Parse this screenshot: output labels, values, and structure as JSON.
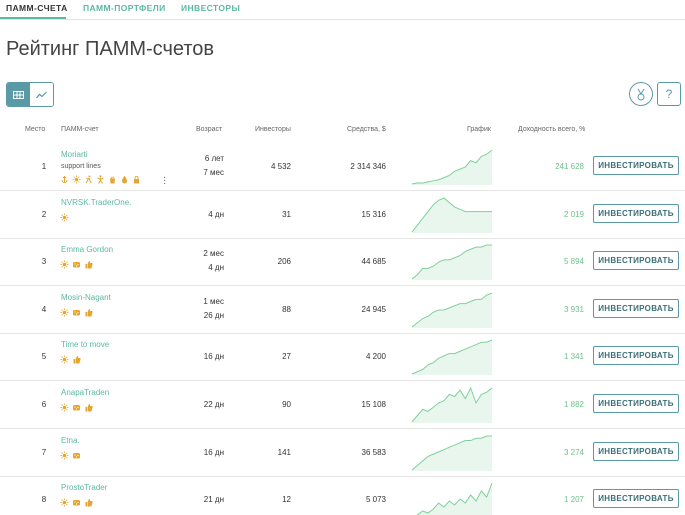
{
  "tabs": [
    {
      "label": "ПАММ-счета",
      "active": true
    },
    {
      "label": "ПАММ-портфели",
      "active": false
    },
    {
      "label": "Инвесторы",
      "active": false
    }
  ],
  "page_title": "Рейтинг ПАММ-счетов",
  "help_label": "?",
  "columns": {
    "rank": "Место",
    "account": "ПАММ-счет",
    "age": "Возраст",
    "investors": "Инвесторы",
    "funds": "Средства, $",
    "chart": "График",
    "yield": "Доходность всего, %"
  },
  "invest_label": "ИНВЕСТИРОВАТЬ",
  "accent_color": "#5cb8a3",
  "yield_color": "#6dc28a",
  "rows": [
    {
      "rank": "1",
      "name": "Moriarti",
      "subtitle": "support lines",
      "age1": "6 лет",
      "age2": "7 мес",
      "investors": "4 532",
      "funds": "2 314 346",
      "yield": "241 628",
      "icons": [
        "anchor-icon",
        "sun-icon",
        "runner-icon",
        "dancer-icon",
        "bag-icon",
        "drop-icon",
        "lock-icon"
      ],
      "has_more": true,
      "spark": [
        2,
        2.5,
        2.4,
        3,
        3.5,
        4,
        5,
        6,
        8,
        9,
        10,
        13,
        12,
        15,
        16,
        18
      ]
    },
    {
      "rank": "2",
      "name": "NVRSK.TraderOne.",
      "subtitle": "",
      "age1": "4 дн",
      "age2": "",
      "investors": "31",
      "funds": "15 316",
      "yield": "2 019",
      "icons": [
        "sun-icon"
      ],
      "has_more": false,
      "spark": [
        2,
        5,
        8,
        11,
        14,
        16,
        17,
        15,
        13,
        12,
        11,
        11,
        11,
        11,
        11,
        11
      ]
    },
    {
      "rank": "3",
      "name": "Emma Gordon",
      "subtitle": "",
      "age1": "2 мес",
      "age2": "4 дн",
      "investors": "206",
      "funds": "44 685",
      "yield": "5 894",
      "icons": [
        "sun-icon",
        "cookie-icon",
        "thumb-icon"
      ],
      "has_more": false,
      "spark": [
        1,
        3,
        6,
        6,
        7,
        9,
        10,
        10,
        11,
        12,
        14,
        15,
        16,
        16,
        17,
        17
      ]
    },
    {
      "rank": "4",
      "name": "Mosin-Nagant",
      "subtitle": "",
      "age1": "1 мес",
      "age2": "26 дн",
      "investors": "88",
      "funds": "24 945",
      "yield": "3 931",
      "icons": [
        "sun-icon",
        "cookie-icon",
        "thumb-icon"
      ],
      "has_more": false,
      "spark": [
        1,
        3,
        5,
        6,
        8,
        9,
        9,
        10,
        11,
        12,
        12,
        13,
        14,
        14,
        16,
        17
      ]
    },
    {
      "rank": "5",
      "name": "Time to move",
      "subtitle": "",
      "age1": "16 дн",
      "age2": "",
      "investors": "27",
      "funds": "4 200",
      "yield": "1 341",
      "icons": [
        "sun-icon",
        "thumb-icon"
      ],
      "has_more": false,
      "spark": [
        1,
        2,
        3,
        5,
        6,
        8,
        9,
        10,
        10,
        11,
        12,
        13,
        14,
        15,
        15,
        16
      ]
    },
    {
      "rank": "6",
      "name": "AnapaTraden",
      "subtitle": "",
      "age1": "22 дн",
      "age2": "",
      "investors": "90",
      "funds": "15 108",
      "yield": "1 882",
      "icons": [
        "sun-icon",
        "cookie-icon",
        "thumb-icon"
      ],
      "has_more": false,
      "spark": [
        1,
        4,
        7,
        6,
        8,
        10,
        11,
        14,
        13,
        16,
        12,
        17,
        10,
        14,
        15,
        17
      ]
    },
    {
      "rank": "7",
      "name": "Etna.",
      "subtitle": "",
      "age1": "16 дн",
      "age2": "",
      "investors": "141",
      "funds": "36 583",
      "yield": "3 274",
      "icons": [
        "sun-icon",
        "cookie-icon"
      ],
      "has_more": false,
      "spark": [
        1,
        3,
        5,
        7,
        8,
        9,
        10,
        11,
        12,
        13,
        14,
        14,
        15,
        15,
        16,
        16
      ]
    },
    {
      "rank": "8",
      "name": "ProstoTrader",
      "subtitle": "",
      "age1": "21 дн",
      "age2": "",
      "investors": "12",
      "funds": "5 073",
      "yield": "1 207",
      "icons": [
        "sun-icon",
        "cookie-icon",
        "thumb-icon"
      ],
      "has_more": false,
      "spark": [
        1,
        2,
        4,
        3,
        5,
        8,
        6,
        9,
        7,
        10,
        8,
        12,
        9,
        14,
        11,
        18
      ]
    }
  ]
}
